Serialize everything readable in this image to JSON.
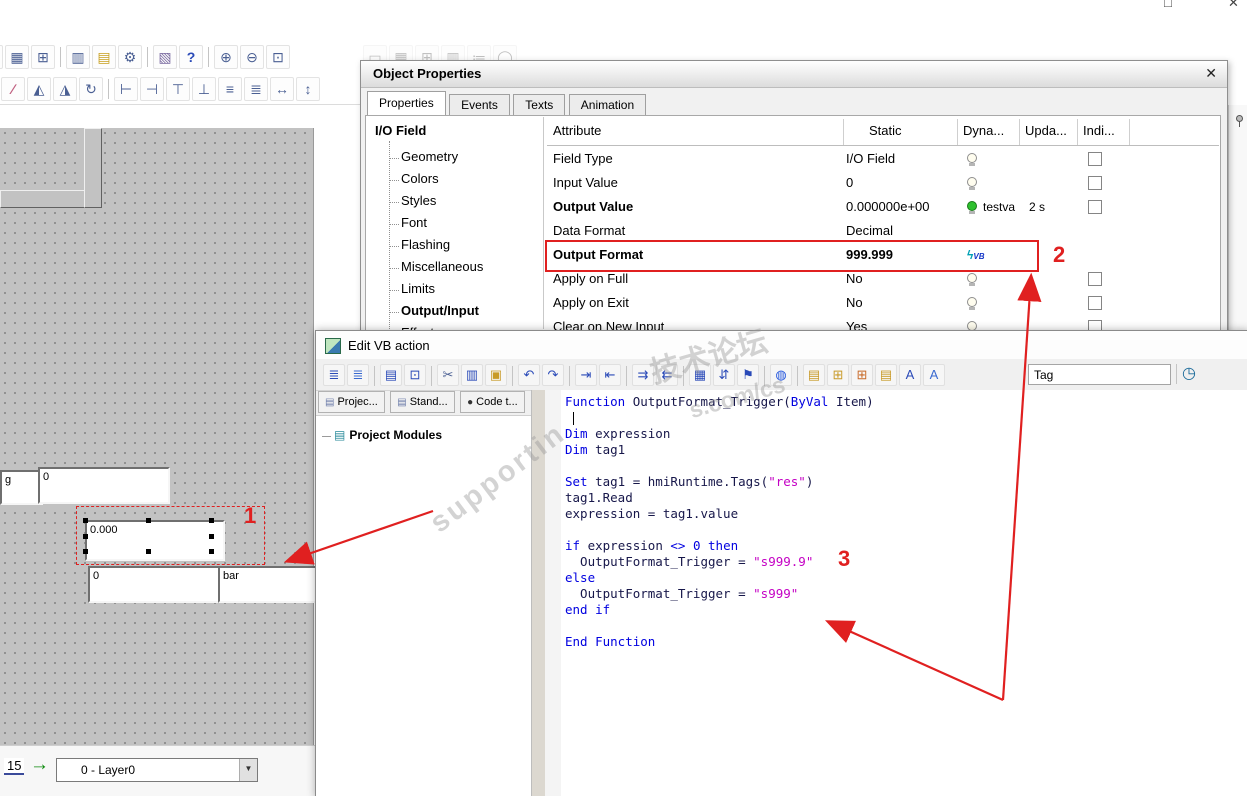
{
  "window": {
    "maximize_glyph": "□",
    "close_glyph": "✕"
  },
  "top_toolbar": {
    "row1": [
      {
        "name": "print-icon",
        "g": "▤",
        "cls": "cut"
      },
      {
        "name": "grid-icon",
        "g": "▦"
      },
      {
        "name": "snap-grid-icon",
        "g": "⊞"
      },
      {
        "sep": true
      },
      {
        "name": "columns-icon",
        "g": "▥"
      },
      {
        "name": "open-folder-icon",
        "g": "▤",
        "cls": "folder"
      },
      {
        "name": "settings-icon",
        "g": "⚙"
      },
      {
        "sep": true
      },
      {
        "name": "library-icon",
        "g": "▧",
        "cls": "lib"
      },
      {
        "name": "help-pointer-icon",
        "g": "?",
        "cls": "help"
      },
      {
        "sep": true
      },
      {
        "name": "zoom-in-icon",
        "g": "⊕"
      },
      {
        "name": "zoom-out-icon",
        "g": "⊖"
      },
      {
        "name": "zoom-region-icon",
        "g": "⊡"
      }
    ],
    "row2": [
      {
        "name": "shear-icon",
        "g": "∕",
        "cls": "pink"
      },
      {
        "name": "flip-vertical-icon",
        "g": "◭"
      },
      {
        "name": "flip-horizontal-icon",
        "g": "◮"
      },
      {
        "name": "rotate-icon",
        "g": "↻"
      },
      {
        "sep": true
      },
      {
        "name": "align-left-icon",
        "g": "⊢"
      },
      {
        "name": "align-right-icon",
        "g": "⊣"
      },
      {
        "name": "align-top-icon",
        "g": "⊤"
      },
      {
        "name": "align-bottom-icon",
        "g": "⊥"
      },
      {
        "name": "center-horizontal-icon",
        "g": "≡"
      },
      {
        "name": "center-vertical-icon",
        "g": "≣"
      },
      {
        "name": "distribute-horizontal-icon",
        "g": "↔"
      },
      {
        "name": "distribute-vertical-icon",
        "g": "↕"
      }
    ],
    "ghost_row": [
      {
        "name": "hidden-toolbar-icon",
        "g": "▭",
        "cls": "ghost"
      },
      {
        "name": "hidden-toolbar-icon",
        "g": "▦",
        "cls": "ghost"
      },
      {
        "name": "hidden-toolbar-icon",
        "g": "⊞",
        "cls": "ghost"
      },
      {
        "name": "hidden-toolbar-icon",
        "g": "▥",
        "cls": "ghost"
      },
      {
        "name": "hidden-toolbar-icon",
        "g": "≔",
        "cls": "ghost"
      },
      {
        "name": "hidden-toolbar-icon",
        "g": "◯",
        "cls": "ghost"
      }
    ]
  },
  "canvas": {
    "partial_field_text": "g",
    "top_field_value": "0",
    "selected_field_value": "0.000",
    "bottom_left_field_value": "0",
    "bottom_right_field_value": "bar"
  },
  "statusbar": {
    "page_tab": "15",
    "arrow_glyph": "→",
    "layer_selector": "0 - Layer0",
    "dropdown_glyph": "▼"
  },
  "object_properties": {
    "title": "Object Properties",
    "close_glyph": "✕",
    "tabs": [
      "Properties",
      "Events",
      "Texts",
      "Animation"
    ],
    "vb_icon": {
      "bolt": "ϟ",
      "text": "VB"
    },
    "tree": {
      "root": "I/O Field",
      "items": [
        {
          "label": "Geometry"
        },
        {
          "label": "Colors"
        },
        {
          "label": "Styles"
        },
        {
          "label": "Font"
        },
        {
          "label": "Flashing"
        },
        {
          "label": "Miscellaneous"
        },
        {
          "label": "Limits"
        },
        {
          "label": "Output/Input"
        },
        {
          "label": "Effects"
        }
      ]
    },
    "table": {
      "headers": [
        "Attribute",
        "Static",
        "Dyna...",
        "Upda...",
        "Indi..."
      ],
      "rows": [
        {
          "attribute": "Field Type",
          "static": "I/O Field"
        },
        {
          "attribute": "Input Value",
          "static": "0"
        },
        {
          "attribute": "Output Value",
          "static": "0.000000e+00",
          "dyn_label": "testva",
          "update": "2 s"
        },
        {
          "attribute": "Data Format",
          "static": "Decimal"
        },
        {
          "attribute": "Output Format",
          "static": "999.999"
        },
        {
          "attribute": "Apply on Full",
          "static": "No"
        },
        {
          "attribute": "Apply on Exit",
          "static": "No"
        },
        {
          "attribute": "Clear on New Input",
          "static": "Yes"
        }
      ]
    }
  },
  "vb_editor": {
    "title": "Edit VB action",
    "tabs": [
      "Projec...",
      "Stand...",
      "Code t..."
    ],
    "tab_icon_glyph": "▤",
    "tab_dot_glyph": "●",
    "tree_root": "Project Modules",
    "tree_icon_glyph": "▤",
    "tag_label": "Tag",
    "trigger_icon_glyph": "◷",
    "toolbar": [
      {
        "name": "module-list-icon",
        "g": "≣",
        "cls": "blue"
      },
      {
        "name": "action-list-icon",
        "g": "≣",
        "cls": "blue2"
      },
      {
        "sep": true
      },
      {
        "name": "print-icon",
        "g": "▤",
        "cls": "blue"
      },
      {
        "name": "print-preview-icon",
        "g": "⊡",
        "cls": "blue"
      },
      {
        "sep": true
      },
      {
        "name": "cut-icon",
        "g": "✂"
      },
      {
        "name": "copy-icon",
        "g": "▥",
        "cls": "blue"
      },
      {
        "name": "paste-icon",
        "g": "▣",
        "cls": "yellow"
      },
      {
        "sep": true
      },
      {
        "name": "undo-icon",
        "g": "↶",
        "cls": "blue"
      },
      {
        "name": "redo-icon",
        "g": "↷",
        "cls": "blue"
      },
      {
        "sep": true
      },
      {
        "name": "indent-icon",
        "g": "⇥",
        "cls": "blue"
      },
      {
        "name": "outdent-icon",
        "g": "⇤",
        "cls": "blue"
      },
      {
        "sep": true
      },
      {
        "name": "comment-icon",
        "g": "⇉",
        "cls": "blue"
      },
      {
        "name": "uncomment-icon",
        "g": "⇇",
        "cls": "blue"
      },
      {
        "sep": true
      },
      {
        "name": "find-icon",
        "g": "▦",
        "cls": "blue"
      },
      {
        "name": "replace-icon",
        "g": "⇵",
        "cls": "blue"
      },
      {
        "name": "bookmark-icon",
        "g": "⚑",
        "cls": "blue"
      },
      {
        "sep": true
      },
      {
        "name": "check-syntax-icon",
        "g": "◍",
        "cls": "bulbblue"
      },
      {
        "sep": true
      },
      {
        "name": "modules-book-icon",
        "g": "▤",
        "cls": "yellow"
      },
      {
        "name": "add-module-icon",
        "g": "⊞",
        "cls": "yellow"
      },
      {
        "name": "add-action-icon",
        "g": "⊞",
        "cls": "yellowred"
      },
      {
        "name": "code-templates-icon",
        "g": "▤",
        "cls": "yellow"
      },
      {
        "name": "font-icon",
        "g": "A",
        "cls": "blue"
      },
      {
        "name": "goto-icon",
        "g": "A",
        "cls": "blue2"
      }
    ],
    "code_lines": [
      [
        {
          "c": "kw",
          "t": "Function"
        },
        {
          "c": "pl",
          "t": " OutputFormat_Trigger("
        },
        {
          "c": "kw",
          "t": "ByVal"
        },
        {
          "c": "pl",
          "t": " Item)"
        }
      ],
      [],
      [
        {
          "c": "kw",
          "t": "Dim"
        },
        {
          "c": "pl",
          "t": " expression"
        }
      ],
      [
        {
          "c": "kw",
          "t": "Dim"
        },
        {
          "c": "pl",
          "t": " tag1"
        }
      ],
      [],
      [
        {
          "c": "kw",
          "t": "Set"
        },
        {
          "c": "pl",
          "t": " tag1 = hmiRuntime.Tags("
        },
        {
          "c": "str",
          "t": "\"res\""
        },
        {
          "c": "pl",
          "t": ")"
        }
      ],
      [
        {
          "c": "pl",
          "t": "tag1.Read"
        }
      ],
      [
        {
          "c": "pl",
          "t": "expression = tag1.value"
        }
      ],
      [],
      [
        {
          "c": "kw",
          "t": "if"
        },
        {
          "c": "pl",
          "t": " expression "
        },
        {
          "c": "kw",
          "t": "<>"
        },
        {
          "c": "pl",
          "t": " "
        },
        {
          "c": "num",
          "t": "0"
        },
        {
          "c": "kw",
          "t": " then"
        }
      ],
      [
        {
          "c": "pl",
          "t": "  OutputFormat_Trigger = "
        },
        {
          "c": "str",
          "t": "\"s999.9\""
        }
      ],
      [
        {
          "c": "kw",
          "t": "else"
        }
      ],
      [
        {
          "c": "pl",
          "t": "  OutputFormat_Trigger = "
        },
        {
          "c": "str",
          "t": "\"s999\""
        }
      ],
      [
        {
          "c": "kw",
          "t": "end if"
        }
      ],
      [],
      [
        {
          "c": "kw",
          "t": "End Function"
        }
      ]
    ]
  },
  "annotations": {
    "mark1": "1",
    "mark2": "2",
    "mark3": "3"
  },
  "watermark": {
    "fragment1": "技术论坛",
    "fragment2": "s.com/cs",
    "fragment3": "supportin"
  }
}
